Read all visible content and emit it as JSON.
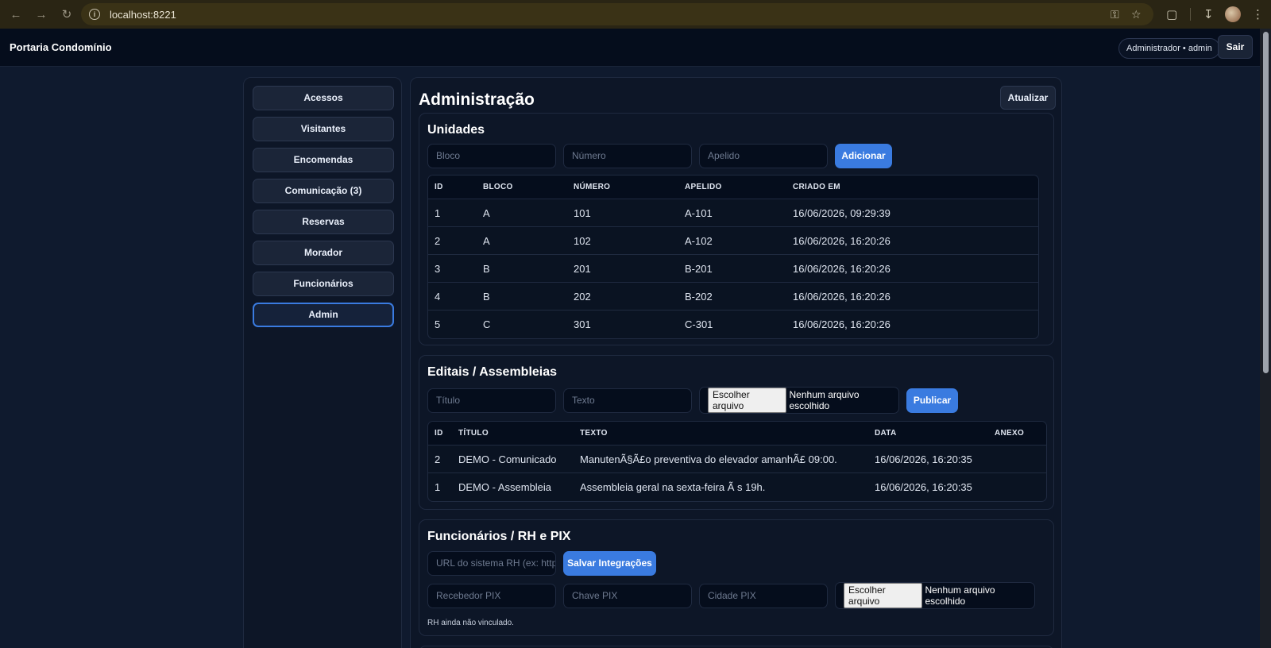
{
  "browser": {
    "url": "localhost:8221"
  },
  "header": {
    "app_title": "Portaria Condomínio",
    "user_label": "Administrador • admin",
    "logout_label": "Sair"
  },
  "sidebar": {
    "items": [
      {
        "label": "Acessos",
        "active": false
      },
      {
        "label": "Visitantes",
        "active": false
      },
      {
        "label": "Encomendas",
        "active": false
      },
      {
        "label": "Comunicação (3)",
        "active": false
      },
      {
        "label": "Reservas",
        "active": false
      },
      {
        "label": "Morador",
        "active": false
      },
      {
        "label": "Funcionários",
        "active": false
      },
      {
        "label": "Admin",
        "active": true
      }
    ]
  },
  "main": {
    "title": "Administração",
    "refresh_label": "Atualizar"
  },
  "unidades": {
    "title": "Unidades",
    "placeholders": {
      "bloco": "Bloco",
      "numero": "Número",
      "apelido": "Apelido"
    },
    "add_label": "Adicionar",
    "columns": [
      "ID",
      "BLOCO",
      "NÚMERO",
      "APELIDO",
      "CRIADO EM"
    ],
    "rows": [
      [
        "1",
        "A",
        "101",
        "A-101",
        "16/06/2026, 09:29:39"
      ],
      [
        "2",
        "A",
        "102",
        "A-102",
        "16/06/2026, 16:20:26"
      ],
      [
        "3",
        "B",
        "201",
        "B-201",
        "16/06/2026, 16:20:26"
      ],
      [
        "4",
        "B",
        "202",
        "B-202",
        "16/06/2026, 16:20:26"
      ],
      [
        "5",
        "C",
        "301",
        "C-301",
        "16/06/2026, 16:20:26"
      ]
    ]
  },
  "editais": {
    "title": "Editais / Assembleias",
    "placeholders": {
      "titulo": "Título",
      "texto": "Texto"
    },
    "file_button": "Escolher arquivo",
    "file_status": "Nenhum arquivo escolhido",
    "publish_label": "Publicar",
    "columns": [
      "ID",
      "TÍTULO",
      "TEXTO",
      "DATA",
      "ANEXO"
    ],
    "rows": [
      [
        "2",
        "DEMO - Comunicado",
        "ManutenÃ§Ã£o preventiva do elevador amanhÃ£ 09:00.",
        "16/06/2026, 16:20:35",
        ""
      ],
      [
        "1",
        "DEMO - Assembleia",
        "Assembleia geral na sexta-feira Ã s 19h.",
        "16/06/2026, 16:20:35",
        ""
      ]
    ]
  },
  "funcionarios": {
    "title": "Funcionários / RH e PIX",
    "placeholders": {
      "rh_url": "URL do sistema RH (ex: http",
      "recebedor": "Recebedor PIX",
      "chave": "Chave PIX",
      "cidade": "Cidade PIX"
    },
    "save_label": "Salvar Integrações",
    "file_button": "Escolher arquivo",
    "file_status": "Nenhum arquivo escolhido",
    "status_note": "RH ainda não vinculado."
  },
  "colors": {
    "accent": "#3a7be0",
    "background": "#0f1a2e",
    "panel": "#0d1627"
  }
}
